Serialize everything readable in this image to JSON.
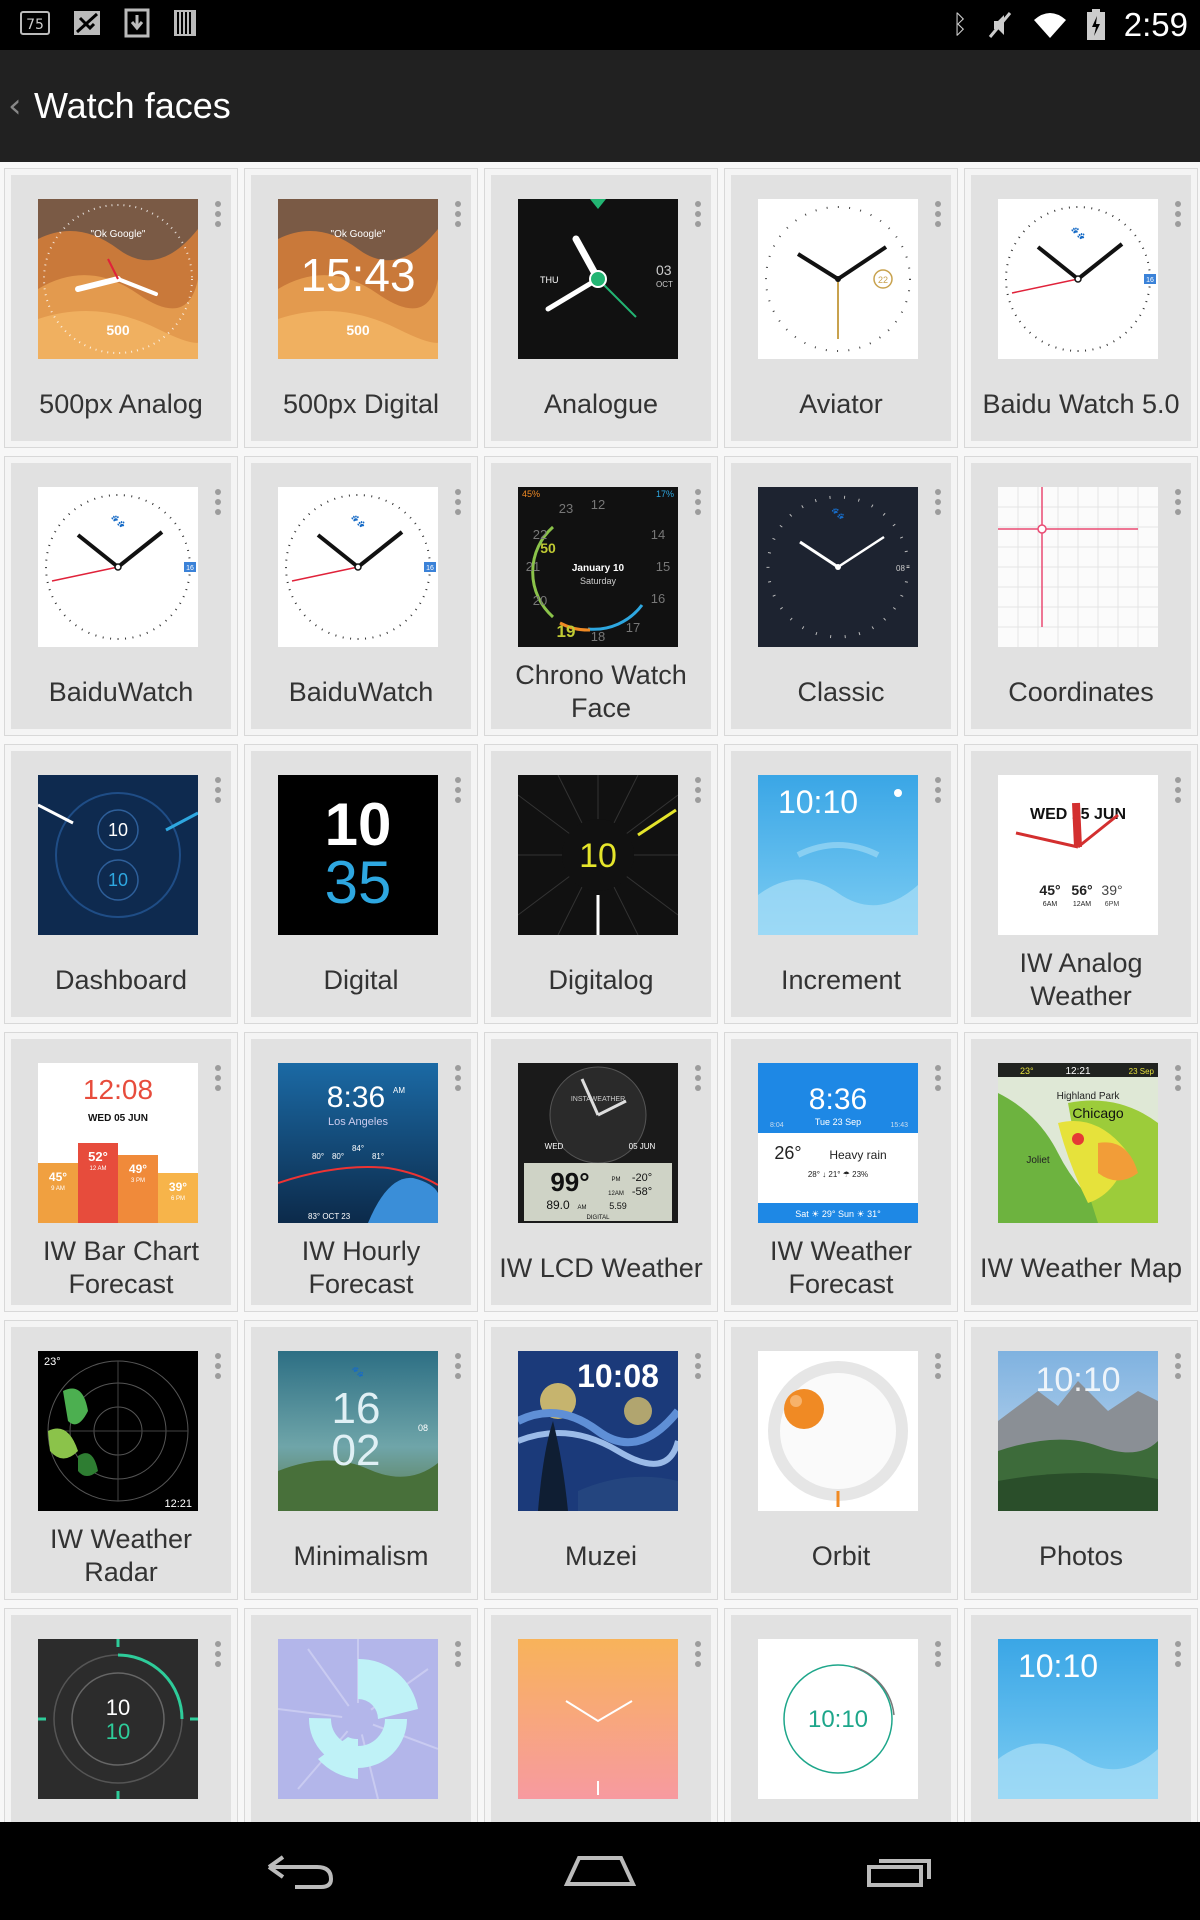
{
  "status_bar": {
    "time": "2:59",
    "notification_badge": "75",
    "icons": [
      "notification-75-icon",
      "sync-off-icon",
      "download-icon",
      "barcode-icon",
      "bluetooth-icon",
      "mute-icon",
      "wifi-icon",
      "battery-charging-icon"
    ]
  },
  "action_bar": {
    "title": "Watch faces"
  },
  "faces": [
    {
      "label": "500px Analog"
    },
    {
      "label": "500px Digital",
      "time_text": "15:43",
      "logo": "500"
    },
    {
      "label": "Analogue",
      "day": "THU",
      "date": "03",
      "month": "OCT"
    },
    {
      "label": "Aviator",
      "date": "22"
    },
    {
      "label": "Baidu Watch 5.0",
      "date": "16"
    },
    {
      "label": "BaiduWatch",
      "date": "16"
    },
    {
      "label": "BaiduWatch",
      "date": "16"
    },
    {
      "label": "Chrono Watch Face",
      "date_text": "January 10",
      "day_text": "Saturday",
      "battery": "45%",
      "phone_battery": "17%",
      "numbers": [
        "12",
        "14",
        "15",
        "16",
        "17",
        "18",
        "19",
        "20",
        "21",
        "22",
        "23",
        "50"
      ]
    },
    {
      "label": "Classic",
      "date": "08"
    },
    {
      "label": "Coordinates"
    },
    {
      "label": "Dashboard",
      "hour": "10",
      "minute": "10"
    },
    {
      "label": "Digital",
      "hour": "10",
      "minute": "35"
    },
    {
      "label": "Digitalog",
      "hour": "10"
    },
    {
      "label": "Increment",
      "time_text": "10:10"
    },
    {
      "label": "IW Analog Weather",
      "date_text": "WED 15 JUN",
      "temps": [
        "45°",
        "56°",
        "39°"
      ],
      "times": [
        "6AM",
        "12AM",
        "6PM"
      ]
    },
    {
      "label": "IW Bar Chart Forecast",
      "time_text": "12:08",
      "date_text": "WED 05 JUN",
      "temps": [
        "45°",
        "52°",
        "49°",
        "39°"
      ],
      "times": [
        "9 AM",
        "12 AM",
        "3 PM",
        "6 PM"
      ]
    },
    {
      "label": "IW Hourly Forecast",
      "time_text": "8:36",
      "ampm": "AM",
      "city": "Los Angeles",
      "temps": [
        "80°",
        "80°",
        "84°",
        "81°"
      ],
      "date_text": "83° OCT 23"
    },
    {
      "label": "IW LCD Weather",
      "brand": "INSTAWEATHER",
      "day": "WED",
      "date_text": "05 JUN",
      "temp": "99°",
      "low1": "-20°",
      "low2": "-58°",
      "time_text": "5.59",
      "sub": "DIGITAL",
      "ampm": "AM",
      "pm": "PM",
      "low_time": "12AM",
      "big_time": "89.0"
    },
    {
      "label": "IW Weather Forecast",
      "time_text": "8:36",
      "date_text": "Tue 23 Sep",
      "temp": "26°",
      "condition": "Heavy rain",
      "details": "28° ↓ 21° ☂ 23%",
      "forecast": "Sat ☀ 29°  Sun ☀ 31°",
      "left_time": "8:04",
      "right_time": "15:43"
    },
    {
      "label": "IW Weather Map",
      "temp": "23°",
      "time_text": "12:21",
      "date_text": "23 Sep",
      "place1": "Highland Park",
      "place2": "Chicago",
      "place3": "Joliet"
    },
    {
      "label": "IW Weather Radar",
      "temp": "23°",
      "time_text": "12:21"
    },
    {
      "label": "Minimalism",
      "hour": "16",
      "minute": "02",
      "date": "08"
    },
    {
      "label": "Muzei",
      "time_text": "10:08"
    },
    {
      "label": "Orbit"
    },
    {
      "label": "Photos",
      "time_text": "10:10"
    },
    {
      "label": "",
      "hour": "10",
      "minute": "10"
    },
    {
      "label": ""
    },
    {
      "label": ""
    },
    {
      "label": "",
      "time_text": "10:10"
    },
    {
      "label": "",
      "time_text": "10:10"
    }
  ]
}
